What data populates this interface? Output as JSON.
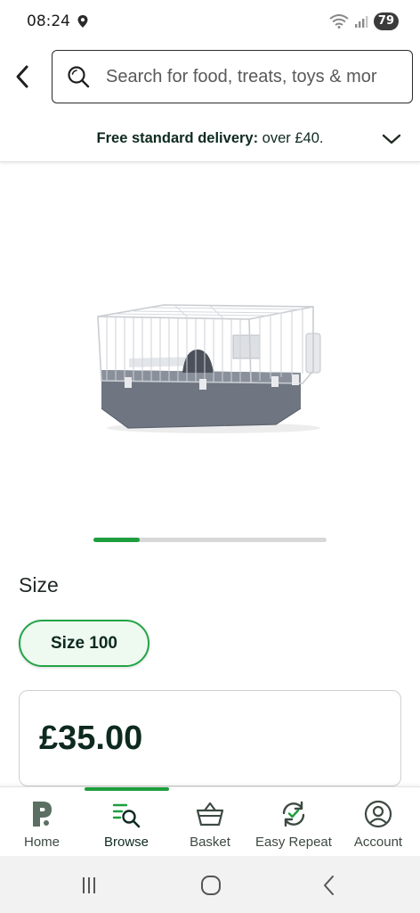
{
  "status_bar": {
    "time": "08:24",
    "battery": "79"
  },
  "search": {
    "placeholder": "Search for food, treats, toys & mor"
  },
  "delivery": {
    "bold": "Free standard delivery:",
    "rest": " over £40."
  },
  "carousel": {
    "progress": 0.2
  },
  "product": {
    "size_label": "Size",
    "selected_size": "Size 100",
    "price": "£35.00"
  },
  "bottom_nav": {
    "items": [
      {
        "label": "Home",
        "icon": "pets-at-home-logo-icon"
      },
      {
        "label": "Browse",
        "icon": "browse-search-icon"
      },
      {
        "label": "Basket",
        "icon": "basket-icon"
      },
      {
        "label": "Easy Repeat",
        "icon": "repeat-icon"
      },
      {
        "label": "Account",
        "icon": "account-icon"
      }
    ],
    "active_index": 1
  },
  "colors": {
    "accent": "#1e9e3e",
    "text": "#0e2a1f",
    "chip_bg": "#eef9f0"
  }
}
